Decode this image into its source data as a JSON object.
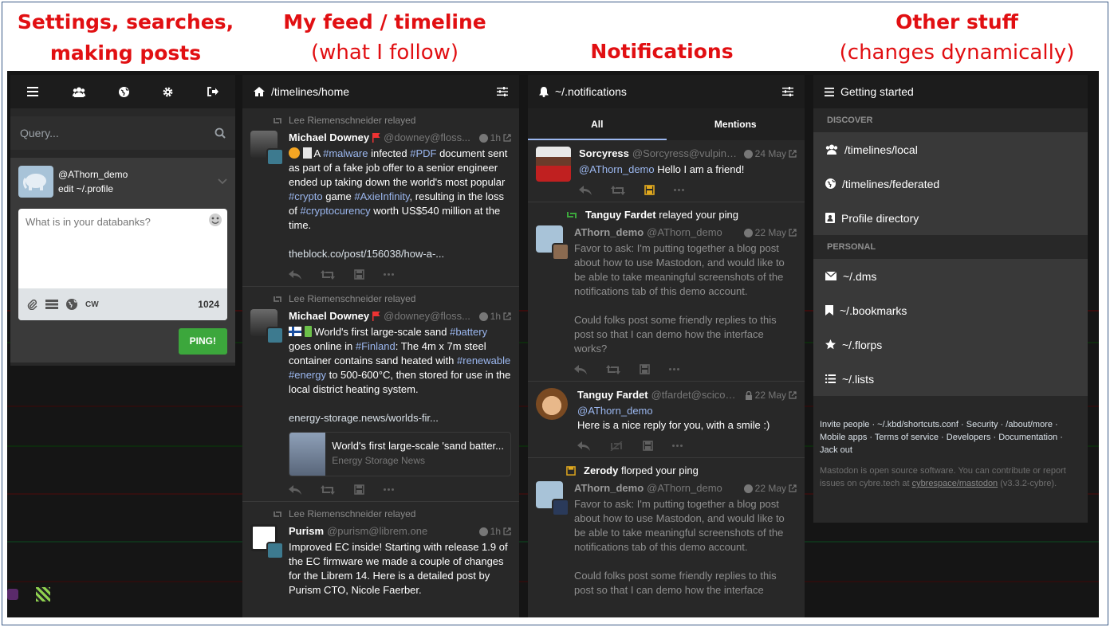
{
  "captions": {
    "c1_line1": "Settings, searches,",
    "c1_line2": "making posts",
    "c2_line1": "My feed / timeline",
    "c2_line2": "(what I follow)",
    "c3_line1": "Notifications",
    "c4_line1": "Other stuff",
    "c4_line2": "(changes dynamically)"
  },
  "compose": {
    "search_placeholder": "Query...",
    "handle": "@AThorn_demo",
    "edit_profile": "edit ~/.profile",
    "textarea_placeholder": "What is in your databanks?",
    "cw_label": "CW",
    "char_count": "1024",
    "submit_label": "PING!"
  },
  "home": {
    "title": "/timelines/home",
    "statuses": [
      {
        "prepend": "Lee Riemenschneider relayed",
        "name": "Michael Downey",
        "acct": "@downey@floss...",
        "time": "1h",
        "text_parts": [
          "A ",
          "#malware",
          " infected ",
          "#PDF",
          " document sent as part of a fake job offer to a senior engineer ended up taking down the world's most popular ",
          "#crypto",
          " game ",
          "#AxieInfinity",
          ", resulting in the loss of ",
          "#cryptocurency",
          " worth US$540 million at the time."
        ],
        "link": "theblock.co/post/156038/how-a-..."
      },
      {
        "prepend": "Lee Riemenschneider relayed",
        "name": "Michael Downey",
        "acct": "@downey@floss...",
        "time": "1h",
        "text_parts": [
          " World's first large-scale sand ",
          "#battery",
          " goes online in ",
          "#Finland",
          ": The 4m x 7m steel container contains sand heated with ",
          "#renewable",
          " ",
          "#energy",
          " to 500-600°C, then stored for use in the local district heating system."
        ],
        "link": "energy-storage.news/worlds-fir...",
        "card_title": "World's first large-scale 'sand batter...",
        "card_source": "Energy Storage News"
      },
      {
        "prepend": "Lee Riemenschneider relayed",
        "name": "Purism",
        "acct": "@purism@librem.one",
        "time": "1h",
        "text": "Improved EC inside! Starting with release 1.9 of the EC firmware we made a couple of changes for the Librem 14. Here is a detailed post by Purism CTO, Nicole Faerber."
      }
    ]
  },
  "notifications": {
    "title": "~/.notifications",
    "tab_all": "All",
    "tab_mentions": "Mentions",
    "items": [
      {
        "name": "Sorcyress",
        "acct": "@Sorcyress@vulpine.cl...",
        "time": "24 May",
        "mention": "@AThorn_demo",
        "text": " Hello I am a friend!"
      },
      {
        "notice_name": "Tanguy Fardet",
        "notice_rest": " relayed your ping",
        "name": "AThorn_demo",
        "acct": "@AThorn_demo",
        "time": "22 May",
        "p1": "Favor to ask: I'm putting together a blog post about how to use Mastodon, and would like to be able to take meaningful screenshots of the notifications tab of this demo account.",
        "p2": "Could folks post some friendly replies to this post so that I can demo how the interface works?"
      },
      {
        "name": "Tanguy Fardet",
        "acct": "@tfardet@scicom...",
        "time": "22 May",
        "mention": "@AThorn_demo",
        "text": "Here is a nice reply for you, with a smile :)"
      },
      {
        "notice_name": "Zerody",
        "notice_rest": " florped your ping",
        "name": "AThorn_demo",
        "acct": "@AThorn_demo",
        "time": "22 May",
        "p1": "Favor to ask: I'm putting together a blog post about how to use Mastodon, and would like to be able to take meaningful screenshots of the notifications tab of this demo account.",
        "p2": "Could folks post some friendly replies to this post so that I can demo how the interface"
      }
    ]
  },
  "started": {
    "title": "Getting started",
    "discover": "DISCOVER",
    "local": "/timelines/local",
    "federated": "/timelines/federated",
    "directory": "Profile directory",
    "personal": "PERSONAL",
    "dms": "~/.dms",
    "bookmarks": "~/.bookmarks",
    "florps": "~/.florps",
    "lists": "~/.lists",
    "footer_links": [
      "Invite people",
      "~/.kbd/shortcuts.conf",
      "Security",
      "/about/more",
      "Mobile apps",
      "Terms of service",
      "Developers",
      "Documentation",
      "Jack out"
    ],
    "footer_note_1": "Mastodon is open source software. You can contribute or report issues on cybre.tech at ",
    "footer_repo": "cybrespace/mastodon",
    "footer_note_2": " (v3.3.2-cybre)."
  },
  "colors": {
    "accent": "#9bb7ef",
    "caption": "#e10f12",
    "ping": "#3ca73c",
    "bg": "#282828"
  }
}
